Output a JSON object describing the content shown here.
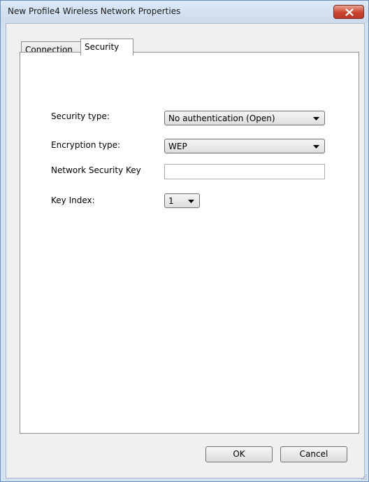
{
  "window": {
    "title": "New Profile4 Wireless Network Properties",
    "close_icon": "close-icon"
  },
  "tabs": [
    {
      "label": "Connection",
      "active": false
    },
    {
      "label": "Security",
      "active": true
    }
  ],
  "security": {
    "security_type_label": "Security type:",
    "security_type_value": "No authentication (Open)",
    "encryption_type_label": "Encryption type:",
    "encryption_type_value": "WEP",
    "network_key_label": "Network Security Key",
    "network_key_value": "",
    "key_index_label": "Key Index:",
    "key_index_value": "1"
  },
  "buttons": {
    "ok_label": "OK",
    "cancel_label": "Cancel"
  },
  "colors": {
    "close_button": "#c9442e",
    "frame_border": "#6f8fb8"
  }
}
